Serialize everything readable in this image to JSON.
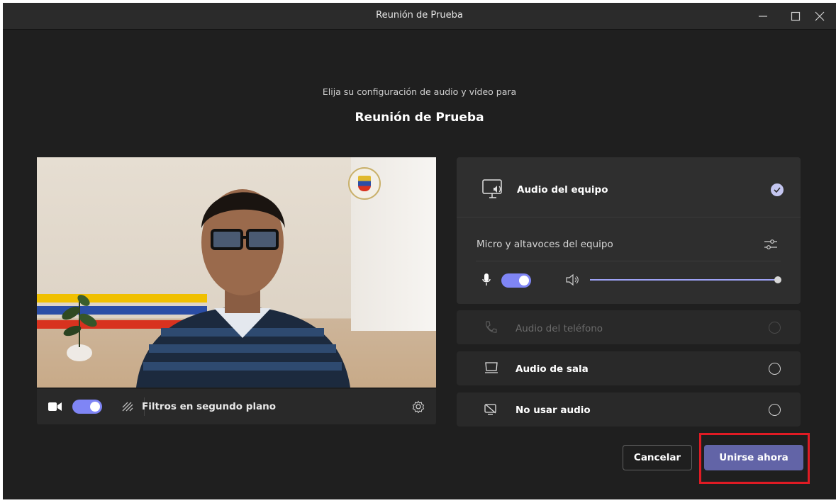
{
  "window": {
    "title": "Reunión de Prueba",
    "controls": [
      "minimize-icon",
      "maximize-icon",
      "close-icon"
    ]
  },
  "prejoin": {
    "subtitle": "Elija su configuración de audio y vídeo para",
    "meeting_name": "Reunión de Prueba"
  },
  "video_bar": {
    "camera_on": true,
    "filters_label": "Filtros en segundo plano"
  },
  "audio_options": {
    "computer": {
      "label": "Audio del equipo",
      "selected": true,
      "device_label": "Micro y altavoces del equipo",
      "mic_on": true,
      "speaker_volume": 1.0
    },
    "phone": {
      "label": "Audio del teléfono",
      "enabled": false
    },
    "room": {
      "label": "Audio de sala"
    },
    "none": {
      "label": "No usar audio"
    }
  },
  "actions": {
    "cancel_label": "Cancelar",
    "join_label": "Unirse ahora"
  },
  "colors": {
    "accent": "#6264a7",
    "toggle": "#7f85f5",
    "highlight": "#e01b24"
  }
}
